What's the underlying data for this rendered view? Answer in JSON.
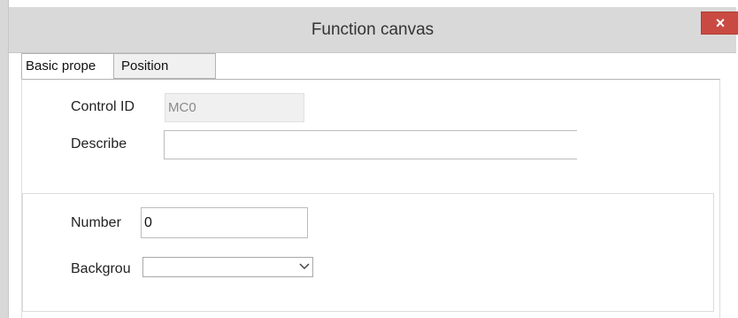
{
  "window": {
    "title": "Function canvas",
    "close_glyph": "×"
  },
  "tabs": [
    {
      "label": "Basic prope",
      "active": true
    },
    {
      "label": "Position",
      "active": false
    }
  ],
  "basic": {
    "control_id_label": "Control ID",
    "control_id_value": "MC0",
    "describe_label": "Describe",
    "describe_value": ""
  },
  "group": {
    "number_label": "Number",
    "number_value": "0",
    "background_label": "Backgrou",
    "background_value": ""
  },
  "colors": {
    "title_bar": "#d9d9d9",
    "close_button": "#c94a42"
  }
}
